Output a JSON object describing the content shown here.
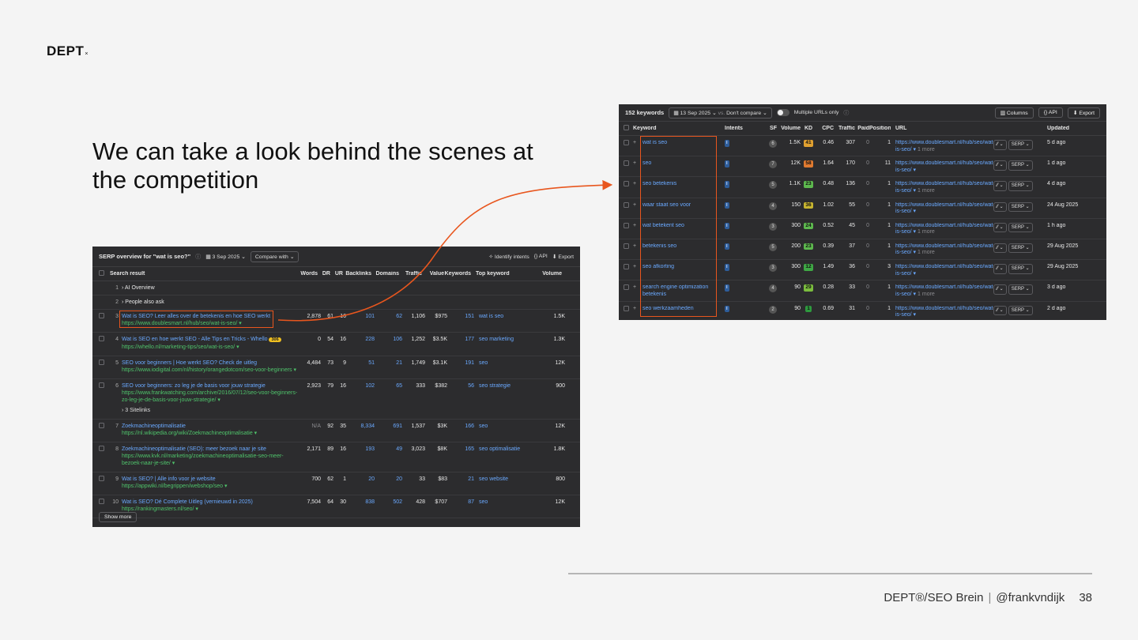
{
  "slide": {
    "logo": "DEPT",
    "logo_mark": "×",
    "headline": "We can take a look behind the scenes at the competition",
    "footer_brand": "DEPT®/SEO Brein",
    "footer_sep": "|",
    "footer_handle": "@frankvndijk",
    "page_number": "38"
  },
  "serp": {
    "title": "SERP overview for \"wat is seo?\"",
    "date": "3 Sep 2025",
    "compare": "Compare with",
    "identify": "Identify intents",
    "api": "API",
    "export": "Export",
    "headers": {
      "result": "Search result",
      "words": "Words",
      "dr": "DR",
      "ur": "UR",
      "backlinks": "Backlinks",
      "domains": "Domains",
      "traffic": "Traffic",
      "value": "Value",
      "keywords": "Keywords",
      "top": "Top keyword",
      "volume": "Volume"
    },
    "special": [
      {
        "num": "1",
        "label": "AI Overview"
      },
      {
        "num": "2",
        "label": "People also ask"
      }
    ],
    "rows": [
      {
        "num": "3",
        "title": "Wat is SEO? Leer alles over de betekenis en hoe SEO werkt",
        "url": "https://www.doublesmart.nl/hub/seo/wat-is-seo/ ▾",
        "words": "2,878",
        "dr": "61",
        "ur": "16",
        "backlinks": "101",
        "domains": "62",
        "traffic": "1,106",
        "value": "$975",
        "keywords": "151",
        "top": "wat is seo",
        "volume": "1.5K"
      },
      {
        "num": "4",
        "title": "Wat is SEO en hoe werkt SEO - Alle Tips en Tricks - Whello",
        "badge": "306",
        "url": "https://whello.nl/marketing-tips/seo/wat-is-seo/ ▾",
        "words": "0",
        "dr": "54",
        "ur": "16",
        "backlinks": "228",
        "domains": "106",
        "traffic": "1,252",
        "value": "$3.5K",
        "keywords": "177",
        "top": "seo marketing",
        "volume": "1.3K"
      },
      {
        "num": "5",
        "title": "SEO voor beginners | Hoe werkt SEO? Check de uitleg",
        "url": "https://www.iodigital.com/nl/history/orangedotcom/seo-voor-beginners ▾",
        "words": "4,484",
        "dr": "73",
        "ur": "9",
        "backlinks": "51",
        "domains": "21",
        "traffic": "1,749",
        "value": "$3.1K",
        "keywords": "191",
        "top": "seo",
        "volume": "12K"
      },
      {
        "num": "6",
        "title": "SEO voor beginners: zo leg je de basis voor jouw strategie",
        "url": "https://www.frankwatching.com/archive/2016/07/12/seo-voor-beginners-zo-leg-je-de-basis-voor-jouw-strategie/ ▾",
        "sitelinks": "3 Sitelinks",
        "words": "2,923",
        "dr": "79",
        "ur": "16",
        "backlinks": "102",
        "domains": "65",
        "traffic": "333",
        "value": "$382",
        "keywords": "56",
        "top": "seo strategie",
        "volume": "900"
      },
      {
        "num": "7",
        "title": "Zoekmachineoptimalisatie",
        "url": "https://nl.wikipedia.org/wiki/Zoekmachineoptimalisatie ▾",
        "words": "N/A",
        "dr": "92",
        "ur": "35",
        "backlinks": "8,334",
        "domains": "691",
        "traffic": "1,537",
        "value": "$3K",
        "keywords": "166",
        "top": "seo",
        "volume": "12K"
      },
      {
        "num": "8",
        "title": "Zoekmachineoptimalisatie (SEO): meer bezoek naar je site",
        "url": "https://www.kvk.nl/marketing/zoekmachineoptimalisatie-seo-meer-bezoek-naar-je-site/ ▾",
        "words": "2,171",
        "dr": "89",
        "ur": "16",
        "backlinks": "193",
        "domains": "49",
        "traffic": "3,023",
        "value": "$8K",
        "keywords": "165",
        "top": "seo optimalisatie",
        "volume": "1.8K"
      },
      {
        "num": "9",
        "title": "Wat is SEO? | Alle info voor je website",
        "url": "https://appwiki.nl/begrippen/webshop/seo ▾",
        "words": "700",
        "dr": "62",
        "ur": "1",
        "backlinks": "20",
        "domains": "20",
        "traffic": "33",
        "value": "$83",
        "keywords": "21",
        "top": "seo website",
        "volume": "800"
      },
      {
        "num": "10",
        "title": "Wat is SEO? Dé Complete Uitleg (vernieuwd in 2025)",
        "url": "https://rankingmasters.nl/seo/ ▾",
        "words": "7,504",
        "dr": "64",
        "ur": "30",
        "backlinks": "838",
        "domains": "502",
        "traffic": "428",
        "value": "$707",
        "keywords": "87",
        "top": "seo",
        "volume": "12K"
      }
    ],
    "show_more": "Show more"
  },
  "kw": {
    "count": "152 keywords",
    "date": "13 Sep 2025",
    "vs": "vs.",
    "compare": "Don't compare",
    "multi": "Multiple URLs only",
    "columns": "Columns",
    "api": "API",
    "export": "Export",
    "headers": {
      "keyword": "Keyword",
      "intents": "Intents",
      "sf": "SF",
      "volume": "Volume",
      "kd": "KD",
      "cpc": "CPC",
      "traffic": "Traffic",
      "paid": "Paid",
      "position": "Position",
      "url": "URL",
      "updated": "Updated"
    },
    "serp_label": "SERP",
    "rows": [
      {
        "kw": "wat is seo",
        "intent": "I",
        "sf": "6",
        "volume": "1.5K",
        "kd": "41",
        "kd_color": "#e0a030",
        "cpc": "0.46",
        "traffic": "307",
        "paid": "0",
        "pos": "1",
        "url": "https://www.doublesmart.nl/hub/seo/wat-is-seo/ ▾",
        "more": "1 more",
        "updated": "5 d ago"
      },
      {
        "kw": "seo",
        "intent": "I",
        "sf": "7",
        "volume": "12K",
        "kd": "58",
        "kd_color": "#e07a30",
        "cpc": "1.64",
        "traffic": "170",
        "paid": "0",
        "pos": "11",
        "url": "https://www.doublesmart.nl/hub/seo/wat-is-seo/ ▾",
        "more": "",
        "updated": "1 d ago"
      },
      {
        "kw": "seo betekenis",
        "intent": "I",
        "sf": "5",
        "volume": "1.1K",
        "kd": "23",
        "kd_color": "#5db84e",
        "cpc": "0.48",
        "traffic": "136",
        "paid": "0",
        "pos": "1",
        "url": "https://www.doublesmart.nl/hub/seo/wat-is-seo/ ▾",
        "more": "1 more",
        "updated": "4 d ago"
      },
      {
        "kw": "waar staat seo voor",
        "intent": "I",
        "sf": "4",
        "volume": "150",
        "kd": "36",
        "kd_color": "#c8b530",
        "cpc": "1.02",
        "traffic": "55",
        "paid": "0",
        "pos": "1",
        "url": "https://www.doublesmart.nl/hub/seo/wat-is-seo/ ▾",
        "more": "",
        "updated": "24 Aug 2025"
      },
      {
        "kw": "wat betekent seo",
        "intent": "I",
        "sf": "3",
        "volume": "300",
        "kd": "24",
        "kd_color": "#5db84e",
        "cpc": "0.52",
        "traffic": "45",
        "paid": "0",
        "pos": "1",
        "url": "https://www.doublesmart.nl/hub/seo/wat-is-seo/ ▾",
        "more": "1 more",
        "updated": "1 h ago"
      },
      {
        "kw": "betekenis seo",
        "intent": "I",
        "sf": "5",
        "volume": "200",
        "kd": "23",
        "kd_color": "#5db84e",
        "cpc": "0.39",
        "traffic": "37",
        "paid": "0",
        "pos": "1",
        "url": "https://www.doublesmart.nl/hub/seo/wat-is-seo/ ▾",
        "more": "1 more",
        "updated": "29 Aug 2025"
      },
      {
        "kw": "seo afkorting",
        "intent": "I",
        "sf": "3",
        "volume": "300",
        "kd": "12",
        "kd_color": "#3fa845",
        "cpc": "1.49",
        "traffic": "36",
        "paid": "0",
        "pos": "3",
        "url": "https://www.doublesmart.nl/hub/seo/wat-is-seo/ ▾",
        "more": "",
        "updated": "29 Aug 2025"
      },
      {
        "kw": "search engine optimization betekenis",
        "intent": "I",
        "sf": "4",
        "volume": "90",
        "kd": "29",
        "kd_color": "#7bbd3e",
        "cpc": "0.28",
        "traffic": "33",
        "paid": "0",
        "pos": "1",
        "url": "https://www.doublesmart.nl/hub/seo/wat-is-seo/ ▾",
        "more": "1 more",
        "updated": "3 d ago"
      },
      {
        "kw": "seo werkzaamheden",
        "intent": "I",
        "sf": "2",
        "volume": "90",
        "kd": "1",
        "kd_color": "#2e9a3e",
        "cpc": "0.69",
        "traffic": "31",
        "paid": "0",
        "pos": "1",
        "url": "https://www.doublesmart.nl/hub/seo/wat-is-seo/ ▾",
        "more": "",
        "updated": "2 d ago"
      }
    ]
  },
  "colors": {
    "accent_orange": "#e8561e",
    "panel_bg": "#2c2c2e",
    "link": "#6aa9ff",
    "url_green": "#4fc36b"
  }
}
